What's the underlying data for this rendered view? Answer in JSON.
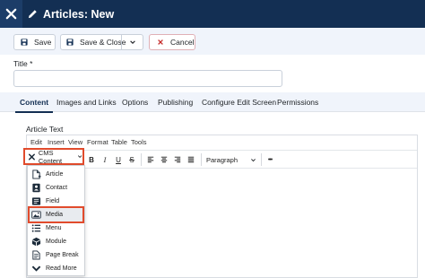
{
  "header": {
    "title": "Articles: New",
    "logo_icon": "joomla-logo",
    "edit_icon": "pencil-icon",
    "bg_color": "#132f53"
  },
  "toolbar": {
    "save_label": "Save",
    "save_close_label": "Save & Close",
    "cancel_label": "Cancel"
  },
  "title_field": {
    "label": "Title *",
    "value": ""
  },
  "tabs": [
    {
      "label": "Content",
      "active": true
    },
    {
      "label": "Images and Links"
    },
    {
      "label": "Options"
    },
    {
      "label": "Publishing"
    },
    {
      "label": "Configure Edit Screen"
    },
    {
      "label": "Permissions"
    }
  ],
  "editor": {
    "label": "Article Text",
    "menubar": [
      "Edit",
      "Insert",
      "View",
      "Format",
      "Table",
      "Tools"
    ],
    "cms_content_label": "CMS Content",
    "bold": "B",
    "italic": "I",
    "underline": "U",
    "strike": "S",
    "format_select": "Paragraph",
    "more": "•••",
    "dropdown_items": [
      {
        "label": "Article",
        "icon": "article-icon"
      },
      {
        "label": "Contact",
        "icon": "contact-icon"
      },
      {
        "label": "Field",
        "icon": "field-icon"
      },
      {
        "label": "Media",
        "icon": "media-icon",
        "selected": true
      },
      {
        "label": "Menu",
        "icon": "menu-icon"
      },
      {
        "label": "Module",
        "icon": "module-icon"
      },
      {
        "label": "Page Break",
        "icon": "page-break-icon"
      },
      {
        "label": "Read More",
        "icon": "read-more-icon"
      }
    ]
  },
  "accent_color": "#e14b2c"
}
